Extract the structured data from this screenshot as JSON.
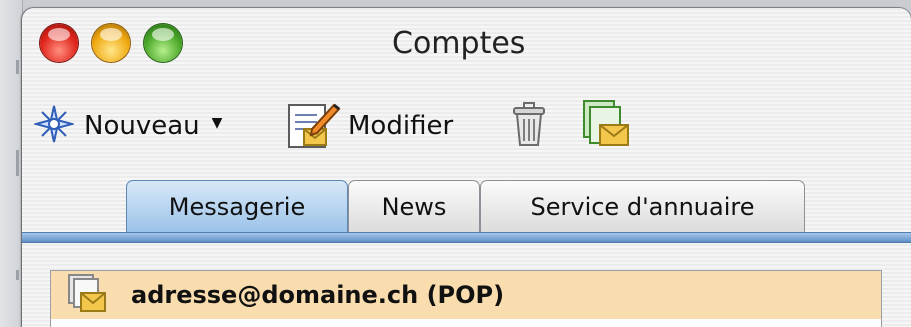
{
  "window": {
    "title": "Comptes",
    "traffic_lights": [
      "close",
      "minimize",
      "zoom"
    ]
  },
  "toolbar": {
    "new_label": "Nouveau",
    "edit_label": "Modifier",
    "new_icon": "sparkle-icon",
    "edit_icon": "edit-document-icon",
    "delete_icon": "trash-icon",
    "default_icon": "mail-account-icon"
  },
  "tabs": [
    {
      "label": "Messagerie",
      "active": true
    },
    {
      "label": "News",
      "active": false
    },
    {
      "label": "Service d'annuaire",
      "active": false
    }
  ],
  "accounts": [
    {
      "label": "adresse@domaine.ch (POP)",
      "selected": true,
      "icon": "mail-account-icon"
    }
  ],
  "colors": {
    "tab_active": "#9cc3e9",
    "tab_underline": "#5f8fc7",
    "selection": "#f9ddae"
  }
}
